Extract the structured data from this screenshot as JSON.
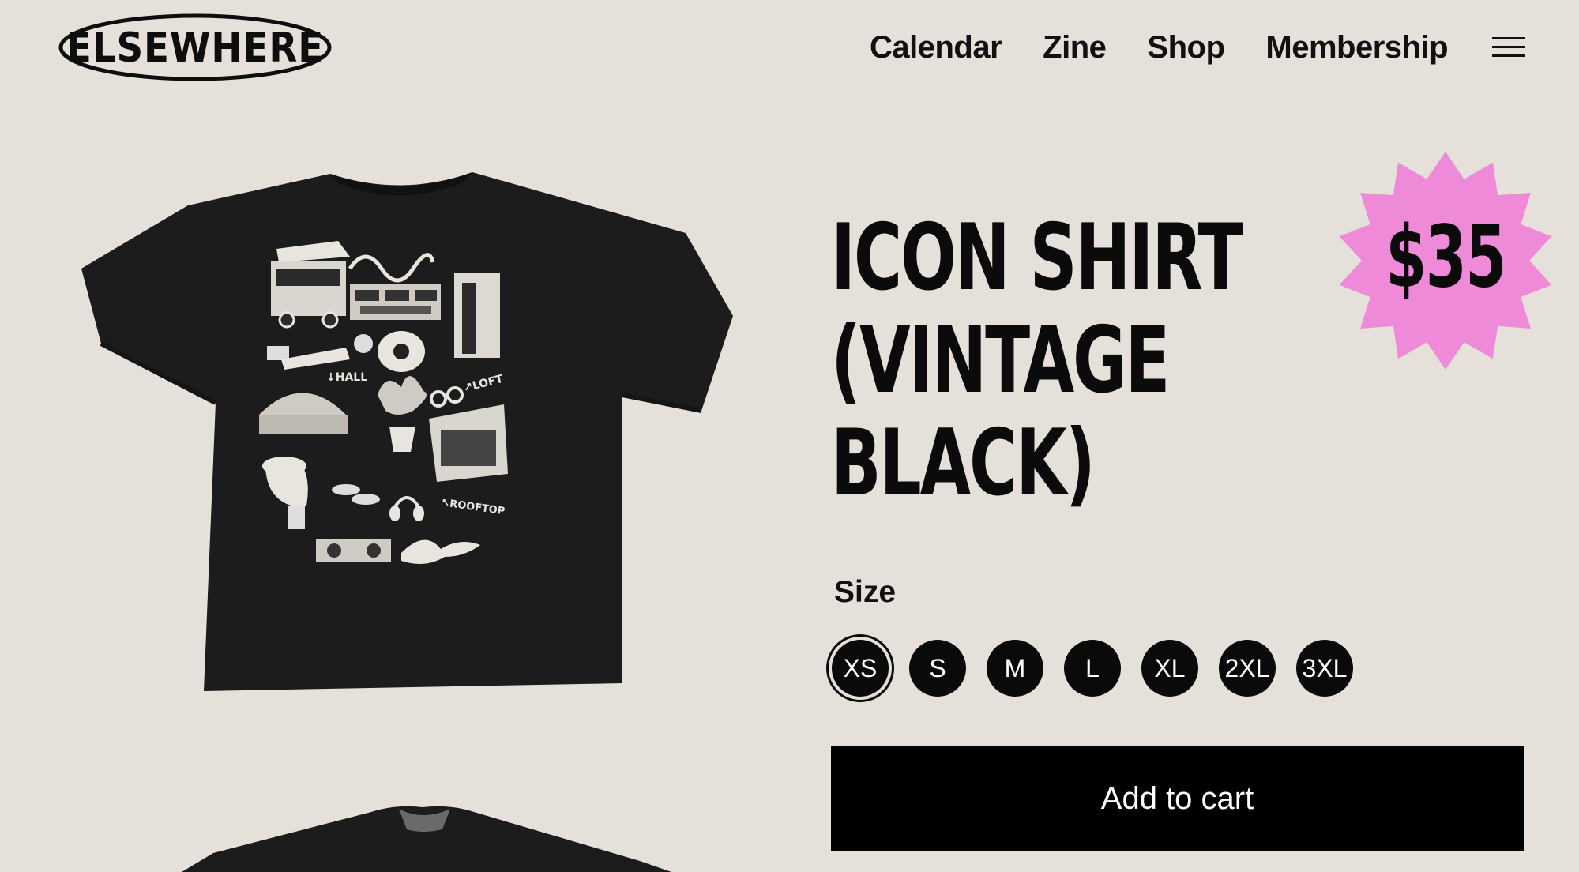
{
  "brand": {
    "name": "ELSEWHERE"
  },
  "nav": {
    "items": [
      "Calendar",
      "Zine",
      "Shop",
      "Membership"
    ],
    "menu_icon": "hamburger-menu-icon"
  },
  "product": {
    "title_lines": [
      "ICON SHIRT",
      "(VINTAGE",
      "BLACK)"
    ],
    "price": "$35",
    "image_text": {
      "hall": "↓HALL",
      "loft": "↗LOFT",
      "rooftop": "↖ROOFTOP"
    },
    "size_label": "Size",
    "sizes": [
      "XS",
      "S",
      "M",
      "L",
      "XL",
      "2XL",
      "3XL"
    ],
    "selected_size": "XS",
    "add_to_cart_label": "Add to cart"
  },
  "colors": {
    "background": "#e5e1da",
    "accent_pink": "#ef8ad8",
    "button": "#000000",
    "shirt": "#1c1c1c"
  }
}
